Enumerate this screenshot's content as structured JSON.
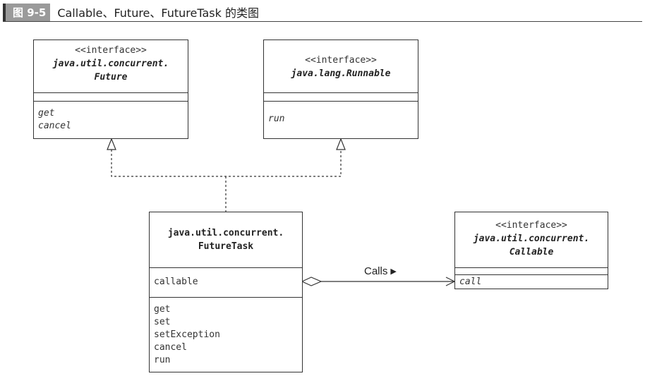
{
  "caption": {
    "label": "图 9-5",
    "title": "Callable、Future、FutureTask 的类图"
  },
  "classes": {
    "future": {
      "stereotype": "<<interface>>",
      "name_line1": "java.util.concurrent.",
      "name_line2": "Future",
      "attributes": [],
      "operations": [
        "get",
        "cancel"
      ]
    },
    "runnable": {
      "stereotype": "<<interface>>",
      "name_line1": "java.lang.Runnable",
      "attributes": [],
      "operations": [
        "run"
      ]
    },
    "futuretask": {
      "name_line1": "java.util.concurrent.",
      "name_line2": "FutureTask",
      "attributes": [
        "callable"
      ],
      "operations": [
        "get",
        "set",
        "setException",
        "cancel",
        "run"
      ]
    },
    "callable": {
      "stereotype": "<<interface>>",
      "name_line1": "java.util.concurrent.",
      "name_line2": "Callable",
      "attributes": [],
      "operations": [
        "call"
      ]
    }
  },
  "relations": {
    "calls_label": "Calls"
  }
}
